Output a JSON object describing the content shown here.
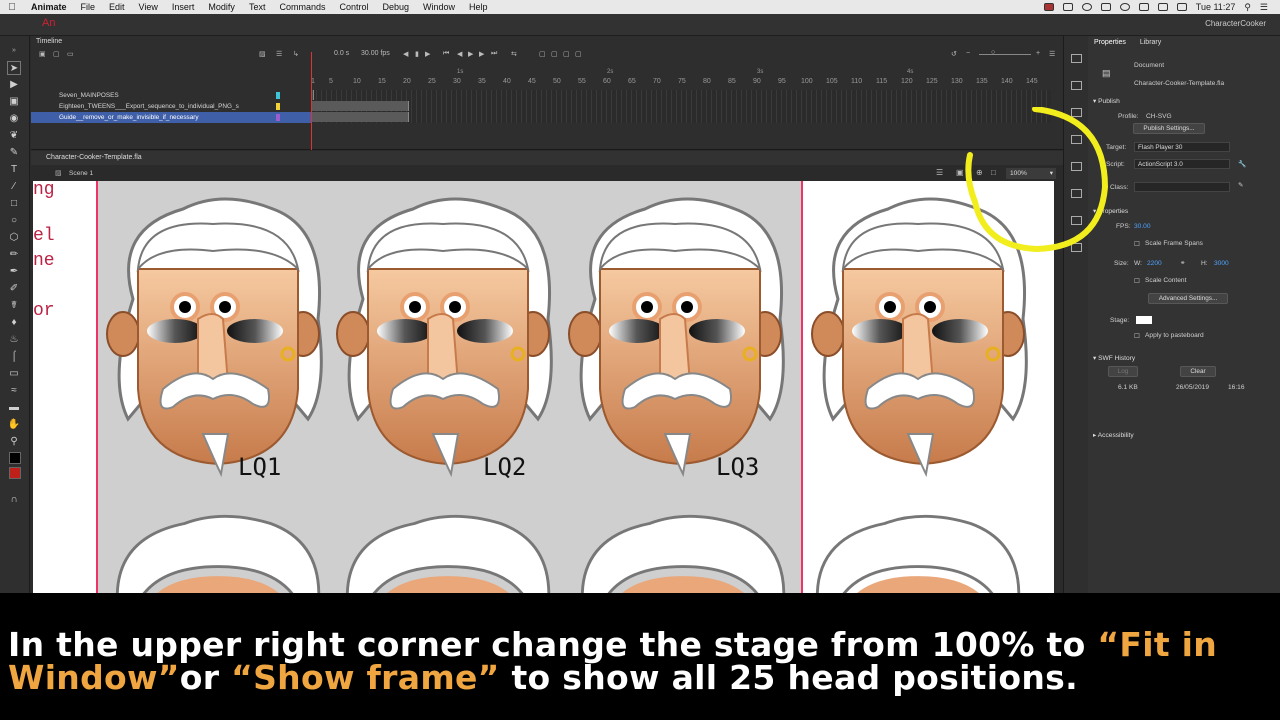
{
  "menubar": {
    "apple": "",
    "items": [
      "Animate",
      "File",
      "Edit",
      "View",
      "Insert",
      "Modify",
      "Text",
      "Commands",
      "Control",
      "Debug",
      "Window",
      "Help"
    ],
    "clock": "Tue 11:27"
  },
  "appbar": {
    "logo": "An",
    "workspace": "CharacterCooker"
  },
  "timeline": {
    "title": "Timeline",
    "frame": "0.0 s",
    "fps": "30.00 fps",
    "frame_numbers": [
      "1",
      "5",
      "10",
      "15",
      "20",
      "25",
      "30",
      "35",
      "40",
      "45",
      "50",
      "55",
      "60",
      "65",
      "70",
      "75",
      "80",
      "85",
      "90",
      "95",
      "100",
      "105",
      "110",
      "115",
      "120",
      "125",
      "130",
      "135",
      "140",
      "145"
    ],
    "seconds": [
      "1s",
      "2s",
      "3s",
      "4s"
    ],
    "layers": [
      {
        "name": "Seven_MAINPOSES",
        "color": "#3ec4d6"
      },
      {
        "name": "Eighteen_TWEENS___Export_sequence_to_individual_PNG_s",
        "color": "#f1d23a"
      },
      {
        "name": "Guide__remove_or_make_invisible_if_necessary",
        "color": "#9b5ed0"
      }
    ]
  },
  "document": {
    "tab": "Character-Cooker-Template.fla",
    "scene": "Scene 1",
    "zoom": "100%"
  },
  "stage": {
    "code_fragments": [
      "ng",
      "el",
      "ne",
      "or"
    ],
    "labels": [
      "LQ1",
      "LQ2",
      "LQ3"
    ]
  },
  "properties": {
    "tabs": [
      "Properties",
      "Library"
    ],
    "doc_label": "Document",
    "doc_name": "Character-Cooker-Template.fla",
    "publish_header": "Publish",
    "profile_label": "Profile:",
    "profile_value": "CH-SVG",
    "publish_settings": "Publish Settings...",
    "target_label": "Target:",
    "target_value": "Flash Player 30",
    "script_label": "Script:",
    "script_value": "ActionScript 3.0",
    "class_label": "Class:",
    "properties_header": "Properties",
    "fps_label": "FPS:",
    "fps_value": "30.00",
    "scale_frame_spans": "Scale Frame Spans",
    "size_label": "Size:",
    "w_label": "W:",
    "w_value": "2200",
    "h_label": "H:",
    "h_value": "3000",
    "scale_content": "Scale Content",
    "advanced_settings": "Advanced Settings...",
    "stage_label": "Stage:",
    "apply_pasteboard": "Apply to pasteboard",
    "swf_history": "SWF History",
    "log": "Log",
    "clear": "Clear",
    "swf_size": "6.1 KB",
    "swf_date": "26/05/2019",
    "swf_time": "16:16",
    "accessibility": "Accessibility"
  },
  "caption": {
    "line1_a": "In the upper right corner change the stage from 100% to ",
    "line1_b": "“Fit in",
    "line2_a": "Window”",
    "line2_b": "or ",
    "line2_c": "“Show frame”",
    "line2_d": " to show all 25 head positions."
  },
  "colors": {
    "highlight": "#f0a640",
    "annotation_ring": "#f2ee1e",
    "selected_layer": "#3f5fa8",
    "stage_guide": "#e33366"
  }
}
